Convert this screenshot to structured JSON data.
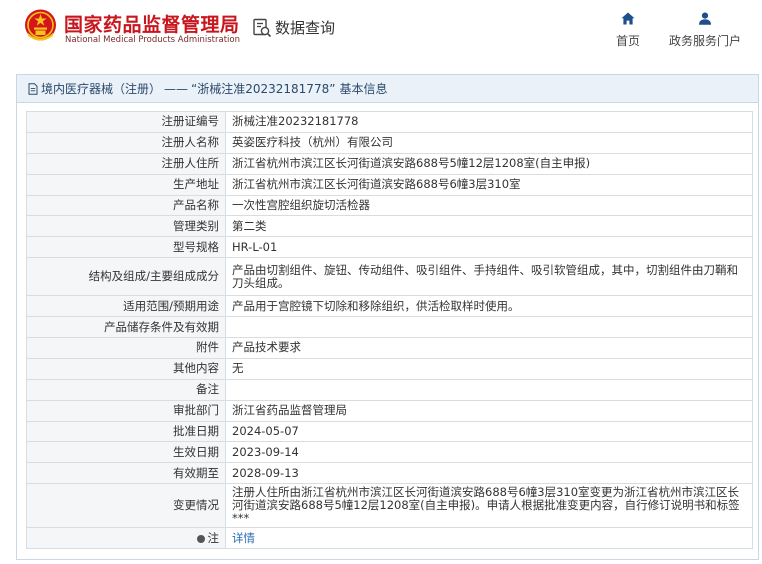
{
  "header": {
    "site_name": "国家药品监督管理局",
    "site_name_en": "National Medical Products Administration",
    "query_label": "数据查询",
    "nav": [
      {
        "label": "首页",
        "icon": "home-icon"
      },
      {
        "label": "政务服务门户",
        "icon": "user-icon"
      }
    ]
  },
  "breadcrumb": {
    "category": "境内医疗器械（注册）",
    "separator": "——",
    "record": "“浙械注准20232181778”",
    "suffix": "基本信息"
  },
  "rows": [
    {
      "key": "注册证编号",
      "value": "浙械注准20232181778"
    },
    {
      "key": "注册人名称",
      "value": "英姿医疗科技（杭州）有限公司"
    },
    {
      "key": "注册人住所",
      "value": "浙江省杭州市滨江区长河街道滨安路688号5幢12层1208室(自主申报)"
    },
    {
      "key": "生产地址",
      "value": "浙江省杭州市滨江区长河街道滨安路688号6幢3层310室"
    },
    {
      "key": "产品名称",
      "value": "一次性宫腔组织旋切活检器"
    },
    {
      "key": "管理类别",
      "value": "第二类"
    },
    {
      "key": "型号规格",
      "value": "HR-L-01"
    },
    {
      "key": "结构及组成/主要组成成分",
      "value": "产品由切割组件、旋钮、传动组件、吸引组件、手持组件、吸引软管组成，其中，切割组件由刀鞘和刀头组成。"
    },
    {
      "key": "适用范围/预期用途",
      "value": "产品用于宫腔镜下切除和移除组织，供活检取样时使用。"
    },
    {
      "key": "产品储存条件及有效期",
      "value": ""
    },
    {
      "key": "附件",
      "value": "产品技术要求"
    },
    {
      "key": "其他内容",
      "value": "无"
    },
    {
      "key": "备注",
      "value": ""
    },
    {
      "key": "审批部门",
      "value": "浙江省药品监督管理局"
    },
    {
      "key": "批准日期",
      "value": "2024-05-07"
    },
    {
      "key": "生效日期",
      "value": "2023-09-14"
    },
    {
      "key": "有效期至",
      "value": "2028-09-13"
    },
    {
      "key": "变更情况",
      "value": "注册人住所由浙江省杭州市滨江区长河街道滨安路688号6幢3层310室变更为浙江省杭州市滨江区长河街道滨安路688号5幢12层1208室(自主申报)。申请人根据批准变更内容，自行修订说明书和标签***"
    }
  ],
  "note": {
    "key": "注",
    "link": "详情"
  },
  "colors": {
    "brand_red": "#c8161d",
    "nav_blue": "#1f4e8c",
    "link_blue": "#2a6bb5",
    "title_bg": "#eaf1f8"
  }
}
